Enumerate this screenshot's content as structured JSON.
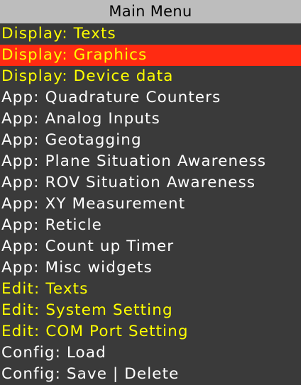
{
  "menu": {
    "title": "Main Menu",
    "header_color": "#bdbdbd",
    "background_color": "#3a3a3a",
    "selected_color": "#ff2b12",
    "selected_index": 1,
    "items": [
      {
        "label": "Display: Texts",
        "color": "#ffff00"
      },
      {
        "label": "Display: Graphics",
        "color": "#ffff00"
      },
      {
        "label": "Display: Device data",
        "color": "#ffff00"
      },
      {
        "label": "App: Quadrature Counters",
        "color": "#ffffff"
      },
      {
        "label": "App: Analog Inputs",
        "color": "#ffffff"
      },
      {
        "label": "App: Geotagging",
        "color": "#ffffff"
      },
      {
        "label": "App: Plane Situation Awareness",
        "color": "#ffffff"
      },
      {
        "label": "App: ROV Situation Awareness",
        "color": "#ffffff"
      },
      {
        "label": "App: XY Measurement",
        "color": "#ffffff"
      },
      {
        "label": "App: Reticle",
        "color": "#ffffff"
      },
      {
        "label": "App: Count up Timer",
        "color": "#ffffff"
      },
      {
        "label": "App: Misc widgets",
        "color": "#ffffff"
      },
      {
        "label": "Edit: Texts",
        "color": "#ffff00"
      },
      {
        "label": "Edit: System Setting",
        "color": "#ffff00"
      },
      {
        "label": "Edit: COM Port Setting",
        "color": "#ffff00"
      },
      {
        "label": "Config: Load",
        "color": "#ffffff"
      },
      {
        "label": "Config: Save | Delete",
        "color": "#ffffff"
      }
    ]
  }
}
